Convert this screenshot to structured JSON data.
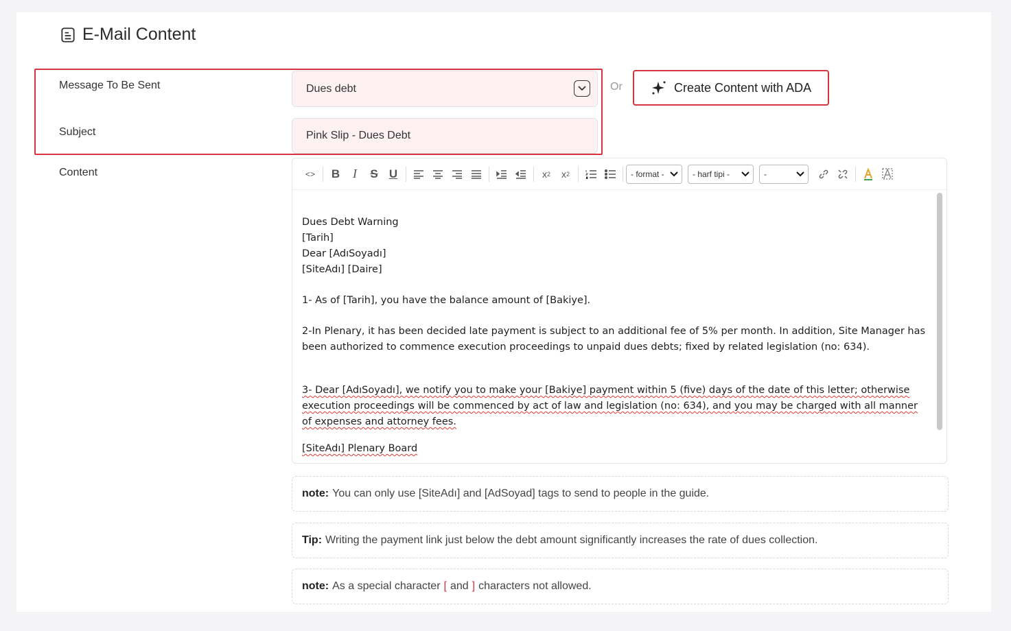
{
  "title": "E-Mail Content",
  "form": {
    "message_label": "Message To Be Sent",
    "message_value": "Dues debt",
    "subject_label": "Subject",
    "subject_value": "Pink Slip - Dues Debt",
    "content_label": "Content"
  },
  "or_text": "Or",
  "ada_button": "Create Content with ADA",
  "toolbar": {
    "format_select": "- format -",
    "font_select": "- harf tipi -",
    "size_select": "-"
  },
  "content": {
    "line1": "Dues Debt Warning",
    "line2": "[Tarih]",
    "line3": "Dear [AdıSoyadı]",
    "line4": "[SiteAdı] [Daire]",
    "para1": "1- As of [Tarih], you have the balance amount of [Bakiye].",
    "para2": "2-In Plenary, it has been decided late payment is subject to an additional fee of 5% per month. In addition, Site Manager has been authorized to commence execution proceedings to unpaid dues debts; fixed by related legislation (no: 634).",
    "para3": "3- Dear [AdıSoyadı], we notify you to make your [Bakiye] payment within 5 (five) days of the date of this letter; otherwise execution proceedings will be commenced by act of law and legislation (no: 634), and you may be charged with all manner of expenses and attorney fees.",
    "sign": "[SiteAdı] Plenary Board"
  },
  "notes": {
    "n1_label": "note:",
    "n1_text": "You can only use [SiteAdı] and [AdSoyad] tags to send to people in the guide.",
    "n2_label": "Tip:",
    "n2_text": "Writing the payment link just below the debt amount significantly increases the rate of dues collection.",
    "n3_label": "note:",
    "n3_pre": "As a special character",
    "n3_open": "[",
    "n3_and": "and",
    "n3_close": "]",
    "n3_post": "characters not allowed."
  },
  "colors": {
    "accent": "#d6333f",
    "field_bg": "#fdf1f3"
  }
}
